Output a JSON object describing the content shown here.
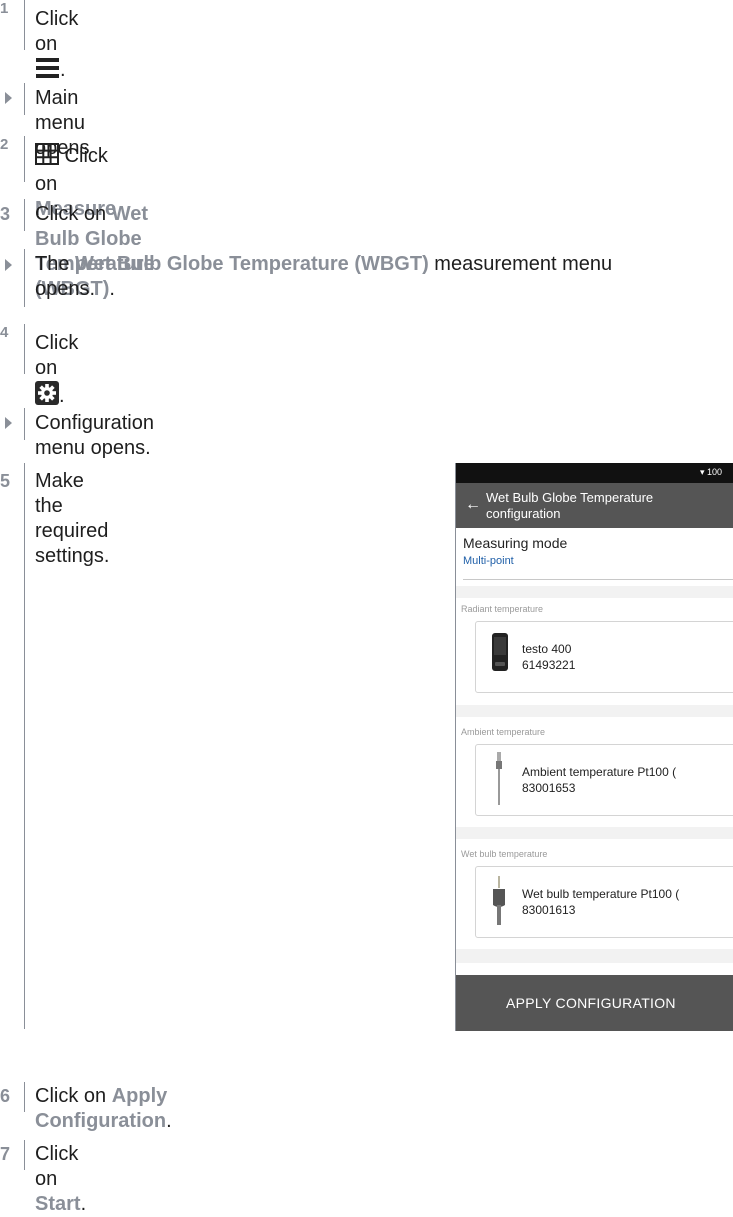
{
  "steps": [
    {
      "id": "s1",
      "marker": "1",
      "type": "number",
      "pre": "Click on ",
      "icon": "hamburger-menu-icon",
      "post": "."
    },
    {
      "id": "r1",
      "type": "result",
      "text": "Main menu opens"
    },
    {
      "id": "s2",
      "marker": "2",
      "type": "number",
      "icon": "grid-icon",
      "pre": " Click on ",
      "bold": "Measure",
      "post": "."
    },
    {
      "id": "s3",
      "marker": "3",
      "type": "number",
      "pre": "Click on ",
      "bold": "Wet Bulb Globe Temperature (WBGT)",
      "post": "."
    },
    {
      "id": "r2",
      "type": "result",
      "pre": "The ",
      "bold": "Wet Bulb Globe Temperature (WBGT)",
      "post": " measurement menu",
      "line2": "opens."
    },
    {
      "id": "s4",
      "marker": "4",
      "type": "number",
      "pre": "Click on ",
      "icon": "gear-icon",
      "post": "."
    },
    {
      "id": "r3",
      "type": "result",
      "text": "Configuration menu opens."
    },
    {
      "id": "s5",
      "marker": "5",
      "type": "number",
      "text": "Make the required settings."
    },
    {
      "id": "s6",
      "marker": "6",
      "type": "number",
      "pre": "Click on ",
      "bold": "Apply Configuration",
      "post": "."
    },
    {
      "id": "s7",
      "marker": "7",
      "type": "number",
      "pre": "Click on ",
      "bold": "Start",
      "post": "."
    }
  ],
  "phone": {
    "status_text": "▾ 100",
    "header_back": "←",
    "header_title_line1": "Wet Bulb Globe Temperature",
    "header_title_line2": "configuration",
    "measuring_mode_label": "Measuring mode",
    "measuring_mode_value": "Multi-point",
    "sections": [
      {
        "label": "Radiant temperature",
        "device_name": "testo 400",
        "device_id": "61493221",
        "icon": "handheld-device-icon"
      },
      {
        "label": "Ambient temperature",
        "device_name": "Ambient temperature Pt100 (",
        "device_id": "83001653",
        "icon": "temperature-probe-icon"
      },
      {
        "label": "Wet bulb temperature",
        "device_name": "Wet bulb temperature Pt100 (",
        "device_id": "83001613",
        "icon": "wet-bulb-probe-icon"
      }
    ],
    "apply_button": "APPLY CONFIGURATION"
  },
  "colors": {
    "accent_grey": "#8a8f98",
    "header_grey": "#555555",
    "link_blue": "#1f5fa8"
  }
}
